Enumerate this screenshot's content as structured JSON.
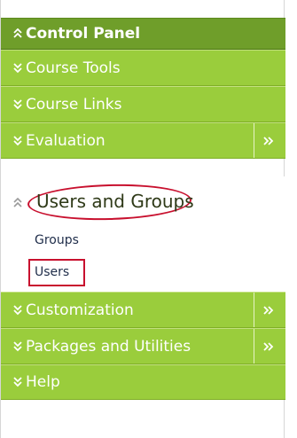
{
  "control_panel": {
    "title": "Control Panel",
    "items": [
      {
        "label": "Course Tools",
        "expanded": false,
        "has_arrow": false
      },
      {
        "label": "Course Links",
        "expanded": false,
        "has_arrow": false
      },
      {
        "label": "Evaluation",
        "expanded": false,
        "has_arrow": true
      },
      {
        "label": "Users and Groups",
        "expanded": true,
        "has_arrow": false,
        "subitems": [
          {
            "label": "Groups"
          },
          {
            "label": "Users"
          }
        ]
      },
      {
        "label": "Customization",
        "expanded": false,
        "has_arrow": true
      },
      {
        "label": "Packages and Utilities",
        "expanded": false,
        "has_arrow": true
      },
      {
        "label": "Help",
        "expanded": false,
        "has_arrow": false
      }
    ]
  },
  "annotations": {
    "highlight_color": "#c8102e"
  },
  "colors": {
    "header_green": "#6f9e2a",
    "row_green": "#9acd3c",
    "text_white": "#ffffff"
  },
  "icons": {
    "collapse": "double-chevron-up-icon",
    "expand": "double-chevron-down-icon",
    "flyout": "double-chevron-right-icon"
  }
}
